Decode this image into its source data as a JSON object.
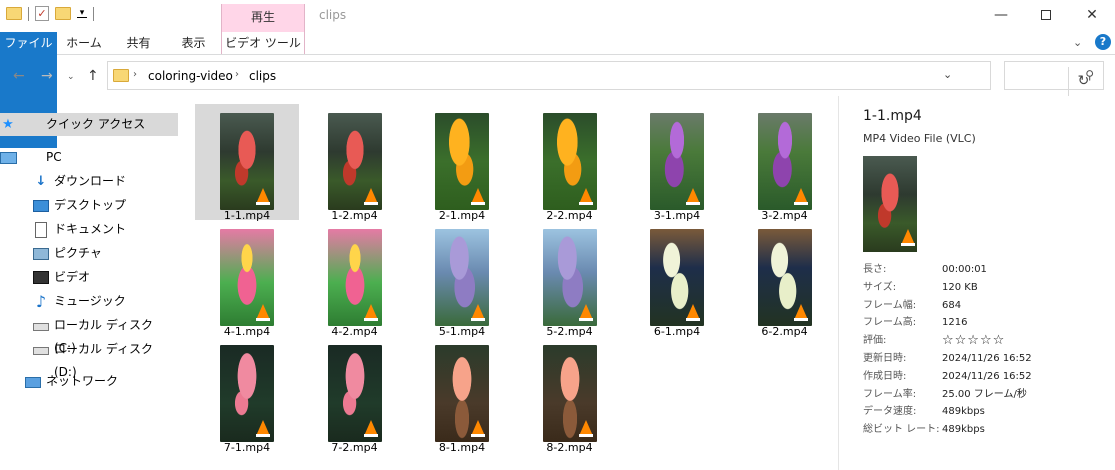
{
  "titlebar": {
    "title": "clips",
    "context_tab_header": "再生",
    "minimize": "—",
    "close": "✕"
  },
  "ribbon": {
    "tabs": [
      "ファイル",
      "ホーム",
      "共有",
      "表示",
      "ビデオ ツール"
    ],
    "help": "?"
  },
  "navbar": {
    "breadcrumb": [
      "coloring-video",
      "clips"
    ],
    "search_placeholder": ""
  },
  "sidebar": {
    "items": [
      {
        "label": "クイック アクセス",
        "icon": "star-icon"
      },
      {
        "label": "PC",
        "icon": "pc-icon"
      },
      {
        "label": "ダウンロード",
        "icon": "download-icon"
      },
      {
        "label": "デスクトップ",
        "icon": "desktop-icon"
      },
      {
        "label": "ドキュメント",
        "icon": "document-icon"
      },
      {
        "label": "ピクチャ",
        "icon": "pictures-icon"
      },
      {
        "label": "ビデオ",
        "icon": "videos-icon"
      },
      {
        "label": "ミュージック",
        "icon": "music-icon"
      },
      {
        "label": "ローカル ディスク (C:)",
        "icon": "drive-icon"
      },
      {
        "label": "ローカル ディスク (D:)",
        "icon": "drive-icon"
      },
      {
        "label": "ネットワーク",
        "icon": "network-icon"
      }
    ]
  },
  "files": [
    {
      "name": "1-1.mp4",
      "theme": "rose",
      "selected": true
    },
    {
      "name": "1-2.mp4",
      "theme": "rose"
    },
    {
      "name": "2-1.mp4",
      "theme": "yellow"
    },
    {
      "name": "2-2.mp4",
      "theme": "yellow"
    },
    {
      "name": "3-1.mp4",
      "theme": "purple"
    },
    {
      "name": "3-2.mp4",
      "theme": "purple"
    },
    {
      "name": "4-1.mp4",
      "theme": "pink"
    },
    {
      "name": "4-2.mp4",
      "theme": "pink"
    },
    {
      "name": "5-1.mp4",
      "theme": "lavender"
    },
    {
      "name": "5-2.mp4",
      "theme": "lavender"
    },
    {
      "name": "6-1.mp4",
      "theme": "white"
    },
    {
      "name": "6-2.mp4",
      "theme": "white"
    },
    {
      "name": "7-1.mp4",
      "theme": "pinkrose"
    },
    {
      "name": "7-2.mp4",
      "theme": "pinkrose"
    },
    {
      "name": "8-1.mp4",
      "theme": "pot"
    },
    {
      "name": "8-2.mp4",
      "theme": "pot"
    }
  ],
  "details": {
    "title": "1-1.mp4",
    "subtitle": "MP4 Video File (VLC)",
    "rows": [
      {
        "key": "長さ:",
        "value": "00:00:01"
      },
      {
        "key": "サイズ:",
        "value": "120 KB"
      },
      {
        "key": "フレーム幅:",
        "value": "684"
      },
      {
        "key": "フレーム高:",
        "value": "1216"
      },
      {
        "key": "評価:",
        "value": "☆☆☆☆☆"
      },
      {
        "key": "更新日時:",
        "value": "2024/11/26 16:52"
      },
      {
        "key": "作成日時:",
        "value": "2024/11/26 16:52"
      },
      {
        "key": "フレーム率:",
        "value": "25.00 フレーム/秒"
      },
      {
        "key": "データ速度:",
        "value": "489kbps"
      },
      {
        "key": "総ビット レート:",
        "value": "489kbps"
      }
    ]
  }
}
